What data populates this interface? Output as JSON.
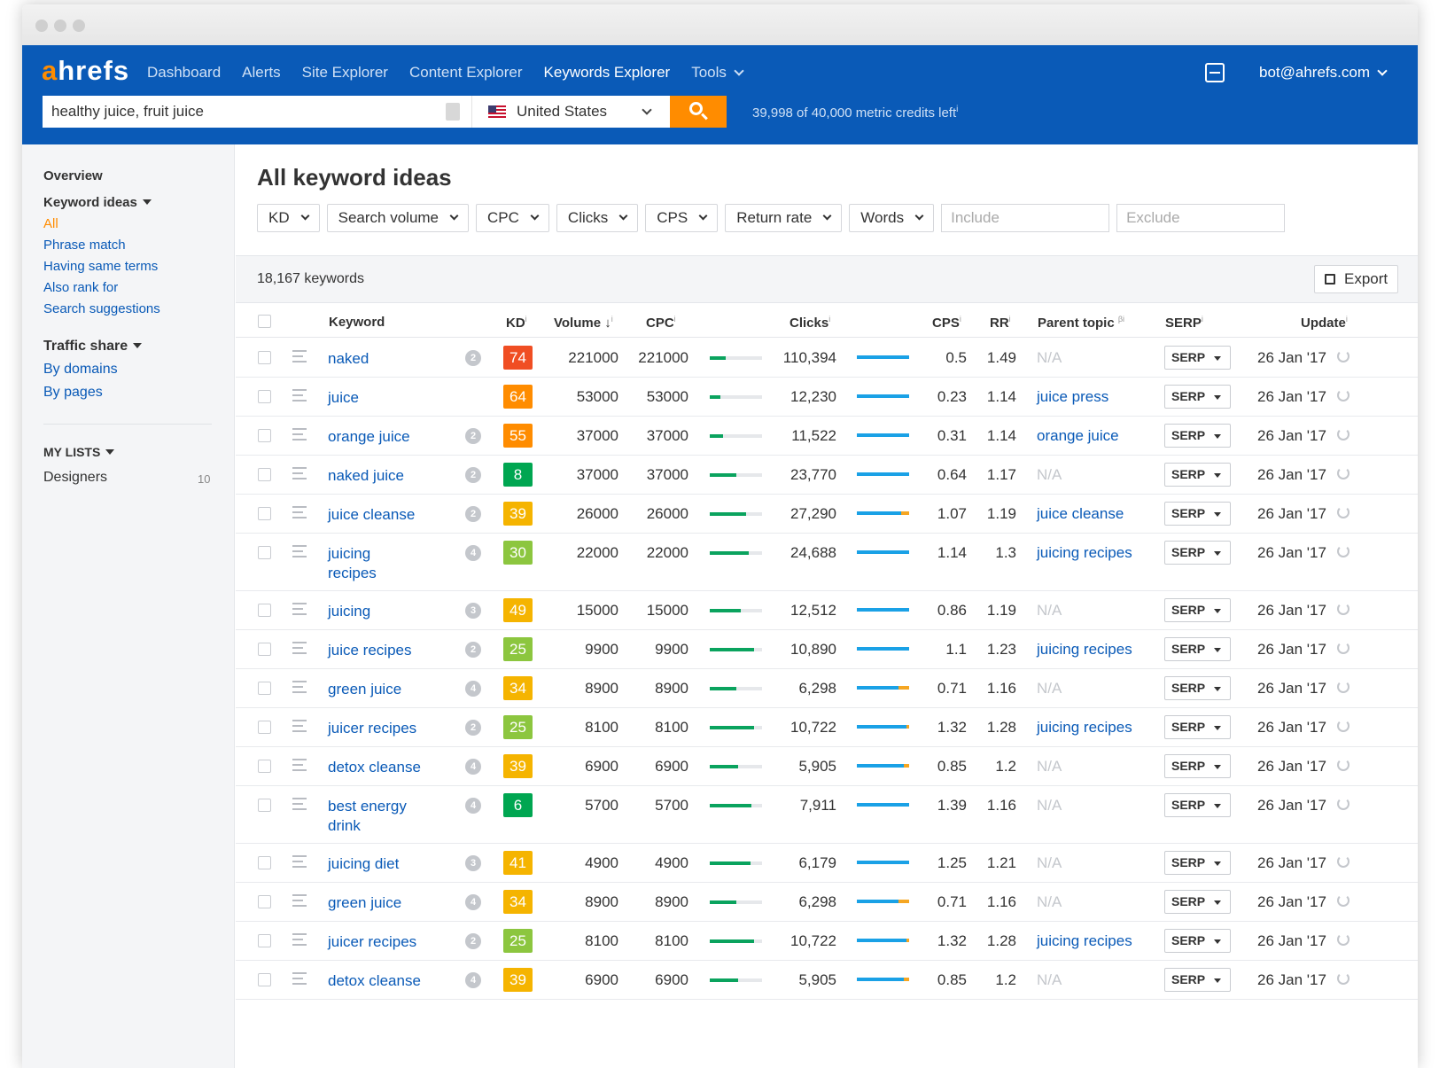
{
  "nav": {
    "logo": "ahrefs",
    "items": [
      "Dashboard",
      "Alerts",
      "Site Explorer",
      "Content Explorer",
      "Keywords Explorer",
      "Tools"
    ],
    "active": "Keywords Explorer",
    "user": "bot@ahrefs.com"
  },
  "search": {
    "query": "healthy juice, fruit juice",
    "country": "United States",
    "credits": "39,998 of 40,000 metric credits left"
  },
  "sidebar": {
    "overview": "Overview",
    "keyword_ideas": "Keyword ideas",
    "keyword_links": [
      "All",
      "Phrase match",
      "Having same terms",
      "Also rank for",
      "Search suggestions"
    ],
    "traffic_share": "Traffic share",
    "traffic_links": [
      "By domains",
      "By pages"
    ],
    "my_lists": "MY LISTS",
    "lists": [
      {
        "name": "Designers",
        "count": "10"
      }
    ]
  },
  "main": {
    "title": "All keyword ideas",
    "filters": [
      "KD",
      "Search volume",
      "CPC",
      "Clicks",
      "CPS",
      "Return rate",
      "Words"
    ],
    "include_placeholder": "Include",
    "exclude_placeholder": "Exclude",
    "results_count": "18,167 keywords",
    "export_label": "Export"
  },
  "table": {
    "headers": {
      "keyword": "Keyword",
      "kd": "KD",
      "volume": "Volume",
      "cpc": "CPC",
      "clicks": "Clicks",
      "cps": "CPS",
      "rr": "RR",
      "parent": "Parent topic",
      "serp": "SERP",
      "update": "Update"
    },
    "serp_label": "SERP",
    "kd_colors": {
      "hard": "#f04e23",
      "high": "#ff8c00",
      "mid": "#f5b400",
      "low": "#8cc63f",
      "easy": "#00a651"
    },
    "rows": [
      {
        "keyword": "naked",
        "words": "2",
        "kd": "74",
        "volume": "221000",
        "cpc": "221000",
        "cpc_level": 0.3,
        "clicks": "110,394",
        "paid_share": 0,
        "cps": "0.5",
        "rr": "1.49",
        "parent": "N/A",
        "update": "26 Jan '17"
      },
      {
        "keyword": "juice",
        "words": "",
        "kd": "64",
        "volume": "53000",
        "cpc": "53000",
        "cpc_level": 0.2,
        "clicks": "12,230",
        "paid_share": 0,
        "cps": "0.23",
        "rr": "1.14",
        "parent": "juice press",
        "update": "26 Jan '17"
      },
      {
        "keyword": "orange juice",
        "words": "2",
        "kd": "55",
        "volume": "37000",
        "cpc": "37000",
        "cpc_level": 0.25,
        "clicks": "11,522",
        "paid_share": 0,
        "cps": "0.31",
        "rr": "1.14",
        "parent": "orange juice",
        "update": "26 Jan '17"
      },
      {
        "keyword": "naked juice",
        "words": "2",
        "kd": "8",
        "volume": "37000",
        "cpc": "37000",
        "cpc_level": 0.5,
        "clicks": "23,770",
        "paid_share": 0,
        "cps": "0.64",
        "rr": "1.17",
        "parent": "N/A",
        "update": "26 Jan '17"
      },
      {
        "keyword": "juice cleanse",
        "words": "2",
        "kd": "39",
        "volume": "26000",
        "cpc": "26000",
        "cpc_level": 0.7,
        "clicks": "27,290",
        "paid_share": 0.15,
        "cps": "1.07",
        "rr": "1.19",
        "parent": "juice cleanse",
        "update": "26 Jan '17"
      },
      {
        "keyword": "juicing recipes",
        "words": "4",
        "kd": "30",
        "volume": "22000",
        "cpc": "22000",
        "cpc_level": 0.75,
        "clicks": "24,688",
        "paid_share": 0,
        "cps": "1.14",
        "rr": "1.3",
        "parent": "juicing recipes",
        "update": "26 Jan '17"
      },
      {
        "keyword": "juicing",
        "words": "3",
        "kd": "49",
        "volume": "15000",
        "cpc": "15000",
        "cpc_level": 0.6,
        "clicks": "12,512",
        "paid_share": 0,
        "cps": "0.86",
        "rr": "1.19",
        "parent": "N/A",
        "update": "26 Jan '17"
      },
      {
        "keyword": "juice recipes",
        "words": "2",
        "kd": "25",
        "volume": "9900",
        "cpc": "9900",
        "cpc_level": 0.85,
        "clicks": "10,890",
        "paid_share": 0,
        "cps": "1.1",
        "rr": "1.23",
        "parent": "juicing recipes",
        "update": "26 Jan '17"
      },
      {
        "keyword": "green juice",
        "words": "4",
        "kd": "34",
        "volume": "8900",
        "cpc": "8900",
        "cpc_level": 0.5,
        "clicks": "6,298",
        "paid_share": 0.2,
        "cps": "0.71",
        "rr": "1.16",
        "parent": "N/A",
        "update": "26 Jan '17"
      },
      {
        "keyword": "juicer recipes",
        "words": "2",
        "kd": "25",
        "volume": "8100",
        "cpc": "8100",
        "cpc_level": 0.85,
        "clicks": "10,722",
        "paid_share": 0.05,
        "cps": "1.32",
        "rr": "1.28",
        "parent": "juicing recipes",
        "update": "26 Jan '17"
      },
      {
        "keyword": "detox cleanse",
        "words": "4",
        "kd": "39",
        "volume": "6900",
        "cpc": "6900",
        "cpc_level": 0.55,
        "clicks": "5,905",
        "paid_share": 0.1,
        "cps": "0.85",
        "rr": "1.2",
        "parent": "N/A",
        "update": "26 Jan '17"
      },
      {
        "keyword": "best energy drink",
        "words": "4",
        "kd": "6",
        "volume": "5700",
        "cpc": "5700",
        "cpc_level": 0.8,
        "clicks": "7,911",
        "paid_share": 0,
        "cps": "1.39",
        "rr": "1.16",
        "parent": "N/A",
        "update": "26 Jan '17"
      },
      {
        "keyword": "juicing diet",
        "words": "3",
        "kd": "41",
        "volume": "4900",
        "cpc": "4900",
        "cpc_level": 0.78,
        "clicks": "6,179",
        "paid_share": 0,
        "cps": "1.25",
        "rr": "1.21",
        "parent": "N/A",
        "update": "26 Jan '17"
      },
      {
        "keyword": "green juice",
        "words": "4",
        "kd": "34",
        "volume": "8900",
        "cpc": "8900",
        "cpc_level": 0.5,
        "clicks": "6,298",
        "paid_share": 0.2,
        "cps": "0.71",
        "rr": "1.16",
        "parent": "N/A",
        "update": "26 Jan '17"
      },
      {
        "keyword": "juicer recipes",
        "words": "2",
        "kd": "25",
        "volume": "8100",
        "cpc": "8100",
        "cpc_level": 0.85,
        "clicks": "10,722",
        "paid_share": 0.05,
        "cps": "1.32",
        "rr": "1.28",
        "parent": "juicing recipes",
        "update": "26 Jan '17"
      },
      {
        "keyword": "detox cleanse",
        "words": "4",
        "kd": "39",
        "volume": "6900",
        "cpc": "6900",
        "cpc_level": 0.55,
        "clicks": "5,905",
        "paid_share": 0.1,
        "cps": "0.85",
        "rr": "1.2",
        "parent": "N/A",
        "update": "26 Jan '17"
      }
    ]
  }
}
